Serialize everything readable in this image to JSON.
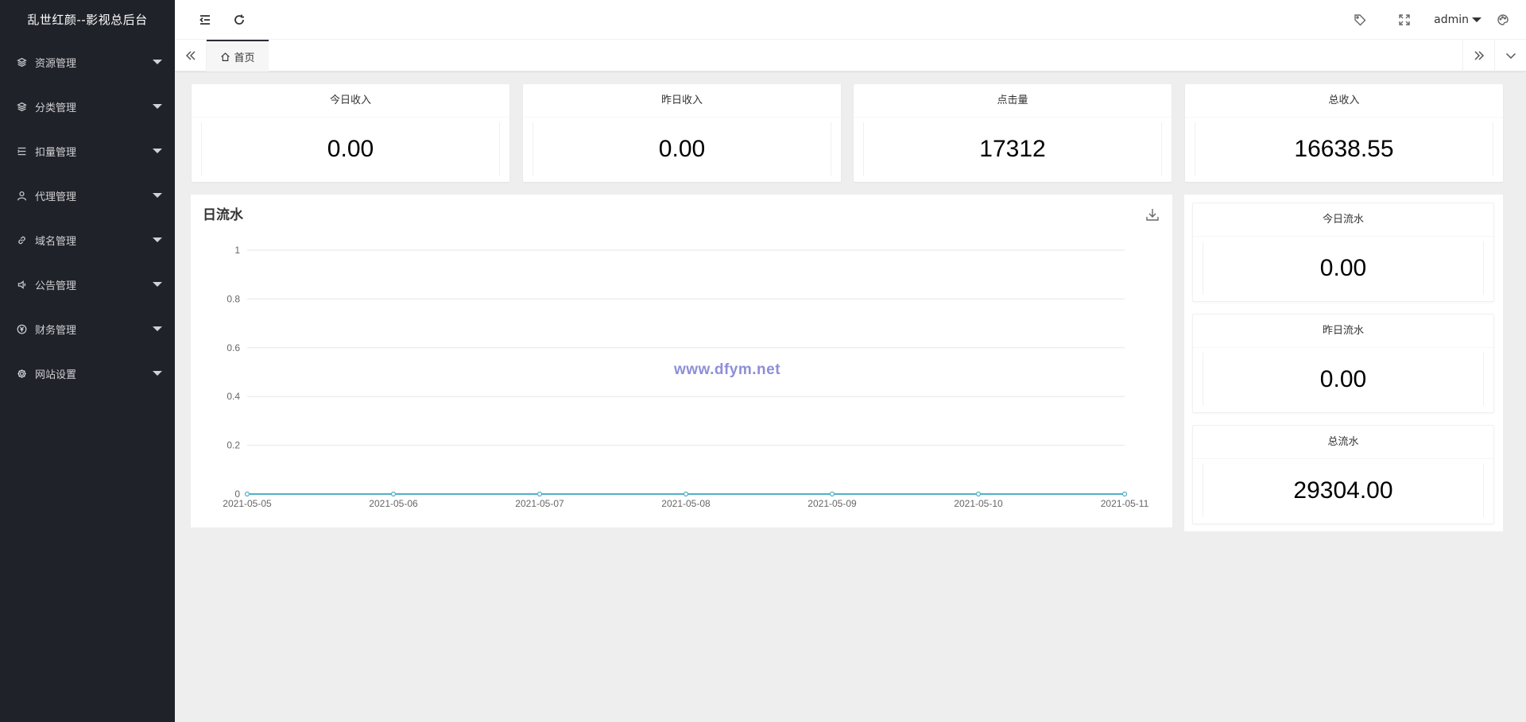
{
  "app": {
    "title": "乱世红颜--影视总后台"
  },
  "sidebar": {
    "items": [
      {
        "label": "资源管理",
        "icon": "layers-icon"
      },
      {
        "label": "分类管理",
        "icon": "layers-icon"
      },
      {
        "label": "扣量管理",
        "icon": "list-icon"
      },
      {
        "label": "代理管理",
        "icon": "user-icon"
      },
      {
        "label": "域名管理",
        "icon": "link-icon"
      },
      {
        "label": "公告管理",
        "icon": "speaker-icon"
      },
      {
        "label": "财务管理",
        "icon": "yen-icon"
      },
      {
        "label": "网站设置",
        "icon": "gear-icon"
      }
    ]
  },
  "header": {
    "user": "admin"
  },
  "tabs": {
    "home": "首页"
  },
  "stats": [
    {
      "label": "今日收入",
      "value": "0.00"
    },
    {
      "label": "昨日收入",
      "value": "0.00"
    },
    {
      "label": "点击量",
      "value": "17312"
    },
    {
      "label": "总收入",
      "value": "16638.55"
    }
  ],
  "chart": {
    "title": "日流水",
    "watermark": "www.dfym.net"
  },
  "chart_data": {
    "type": "line",
    "title": "日流水",
    "categories": [
      "2021-05-05",
      "2021-05-06",
      "2021-05-07",
      "2021-05-08",
      "2021-05-09",
      "2021-05-10",
      "2021-05-11"
    ],
    "series": [
      {
        "values": [
          0,
          0,
          0,
          0,
          0,
          0,
          0
        ],
        "color": "#4fb0c6"
      }
    ],
    "yticks": [
      "0",
      "0.2",
      "0.4",
      "0.6",
      "0.8",
      "1"
    ],
    "ylim": [
      0,
      1
    ],
    "grid": true
  },
  "flow": [
    {
      "label": "今日流水",
      "value": "0.00"
    },
    {
      "label": "昨日流水",
      "value": "0.00"
    },
    {
      "label": "总流水",
      "value": "29304.00"
    }
  ]
}
